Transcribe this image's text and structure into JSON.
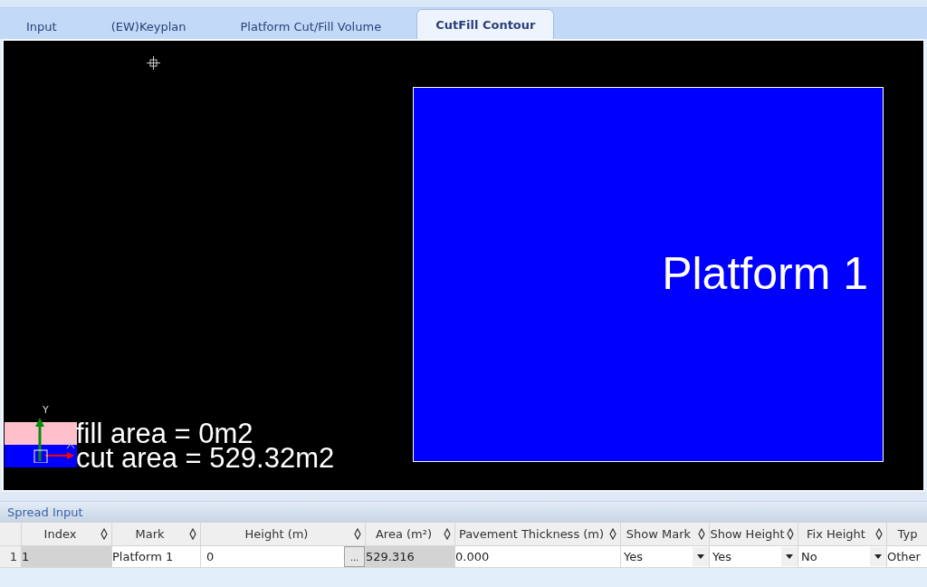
{
  "tabs": [
    {
      "label": "Input",
      "selected": false
    },
    {
      "label": "(EW)Keyplan",
      "selected": false
    },
    {
      "label": "Platform Cut/Fill Volume",
      "selected": false
    },
    {
      "label": "CutFill Contour",
      "selected": true
    }
  ],
  "canvas": {
    "platform": {
      "label": "Platform 1",
      "color": "#0000ff"
    },
    "legend": [
      {
        "label": "fill area = 0m2",
        "color": "#ffc0cb"
      },
      {
        "label": "cut area = 529.32m2",
        "color": "#0000ff"
      }
    ],
    "axis": {
      "y": "Y"
    }
  },
  "spread": {
    "title": "Spread Input",
    "columns": [
      {
        "label": "Index"
      },
      {
        "label": "Mark"
      },
      {
        "label": "Height (m)"
      },
      {
        "label": "Area (m²)"
      },
      {
        "label": "Pavement Thickness (m)"
      },
      {
        "label": "Show Mark"
      },
      {
        "label": "Show Height"
      },
      {
        "label": "Fix Height"
      },
      {
        "label": "Typ"
      }
    ],
    "rows": [
      {
        "header": "1",
        "cells": [
          {
            "kind": "readonly",
            "value": "1"
          },
          {
            "kind": "text",
            "value": "Platform 1"
          },
          {
            "kind": "ellipsis",
            "value": "0",
            "button": "..."
          },
          {
            "kind": "readonly",
            "value": "529.316"
          },
          {
            "kind": "text",
            "value": "0.000"
          },
          {
            "kind": "dropdown",
            "value": "Yes"
          },
          {
            "kind": "dropdown",
            "value": "Yes"
          },
          {
            "kind": "dropdown",
            "value": "No"
          },
          {
            "kind": "text",
            "value": "Other"
          }
        ]
      }
    ]
  }
}
